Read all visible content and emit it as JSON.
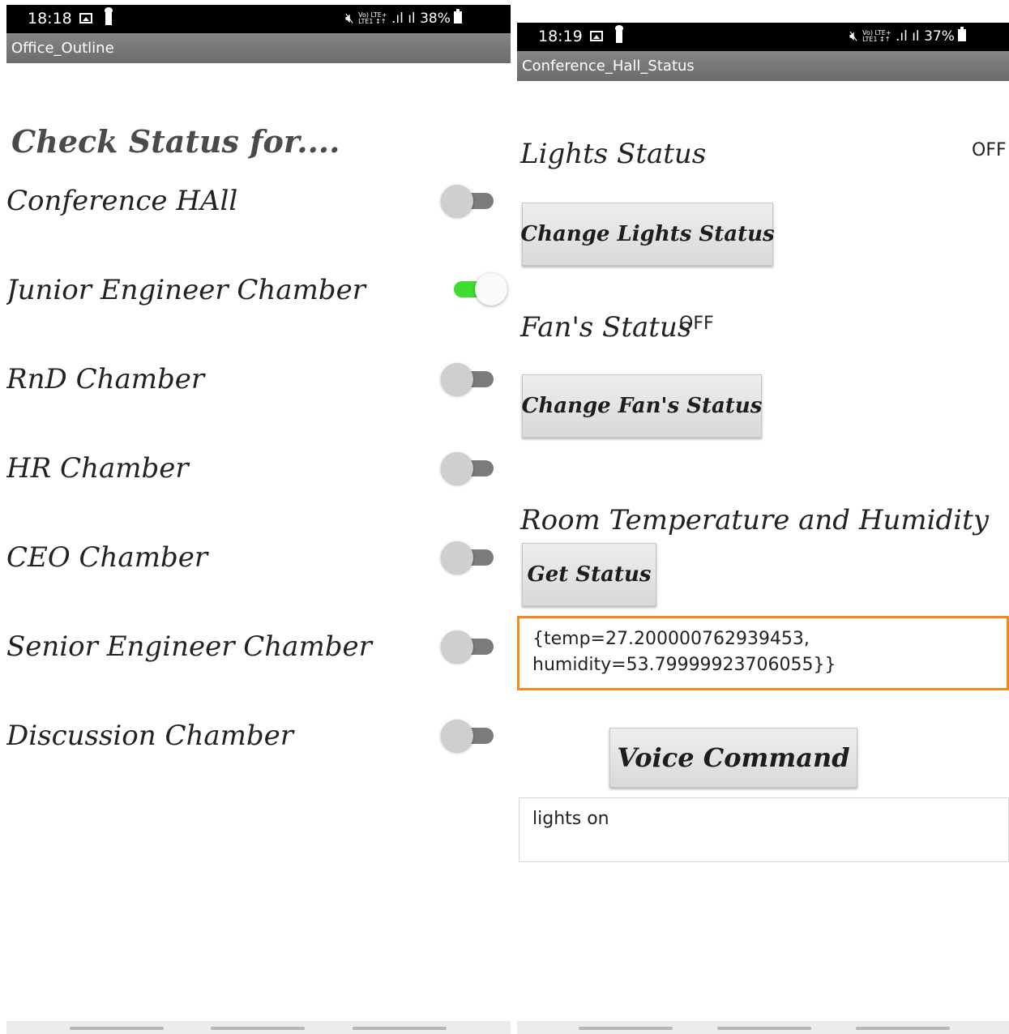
{
  "left_screen": {
    "status_bar": {
      "time": "18:18",
      "signal_small": "Vo) LTE+\nLTE1 ↕↑",
      "battery": "38%"
    },
    "title": "Office_Outline",
    "heading": "Check Status for....",
    "rooms": [
      {
        "label": "Conference HAll",
        "on": false
      },
      {
        "label": "Junior Engineer Chamber",
        "on": true
      },
      {
        "label": "RnD Chamber",
        "on": false
      },
      {
        "label": "HR Chamber",
        "on": false
      },
      {
        "label": "CEO Chamber",
        "on": false
      },
      {
        "label": "Senior Engineer Chamber",
        "on": false
      },
      {
        "label": "Discussion Chamber",
        "on": false
      }
    ]
  },
  "right_screen": {
    "status_bar": {
      "time": "18:19",
      "battery": "37%"
    },
    "title": "Conference_Hall_Status",
    "lights": {
      "label": "Lights Status",
      "value": "OFF",
      "button": "Change Lights Status"
    },
    "fan": {
      "label": "Fan's Status",
      "value": "OFF",
      "button": "Change Fan's Status"
    },
    "climate": {
      "label": "Room Temperature and Humidity",
      "button": "Get Status",
      "output_line1": "{temp=27.200000762939453,",
      "output_line2": "humidity=53.79999923706055}}"
    },
    "voice": {
      "button": "Voice Command",
      "output": "lights on"
    }
  }
}
